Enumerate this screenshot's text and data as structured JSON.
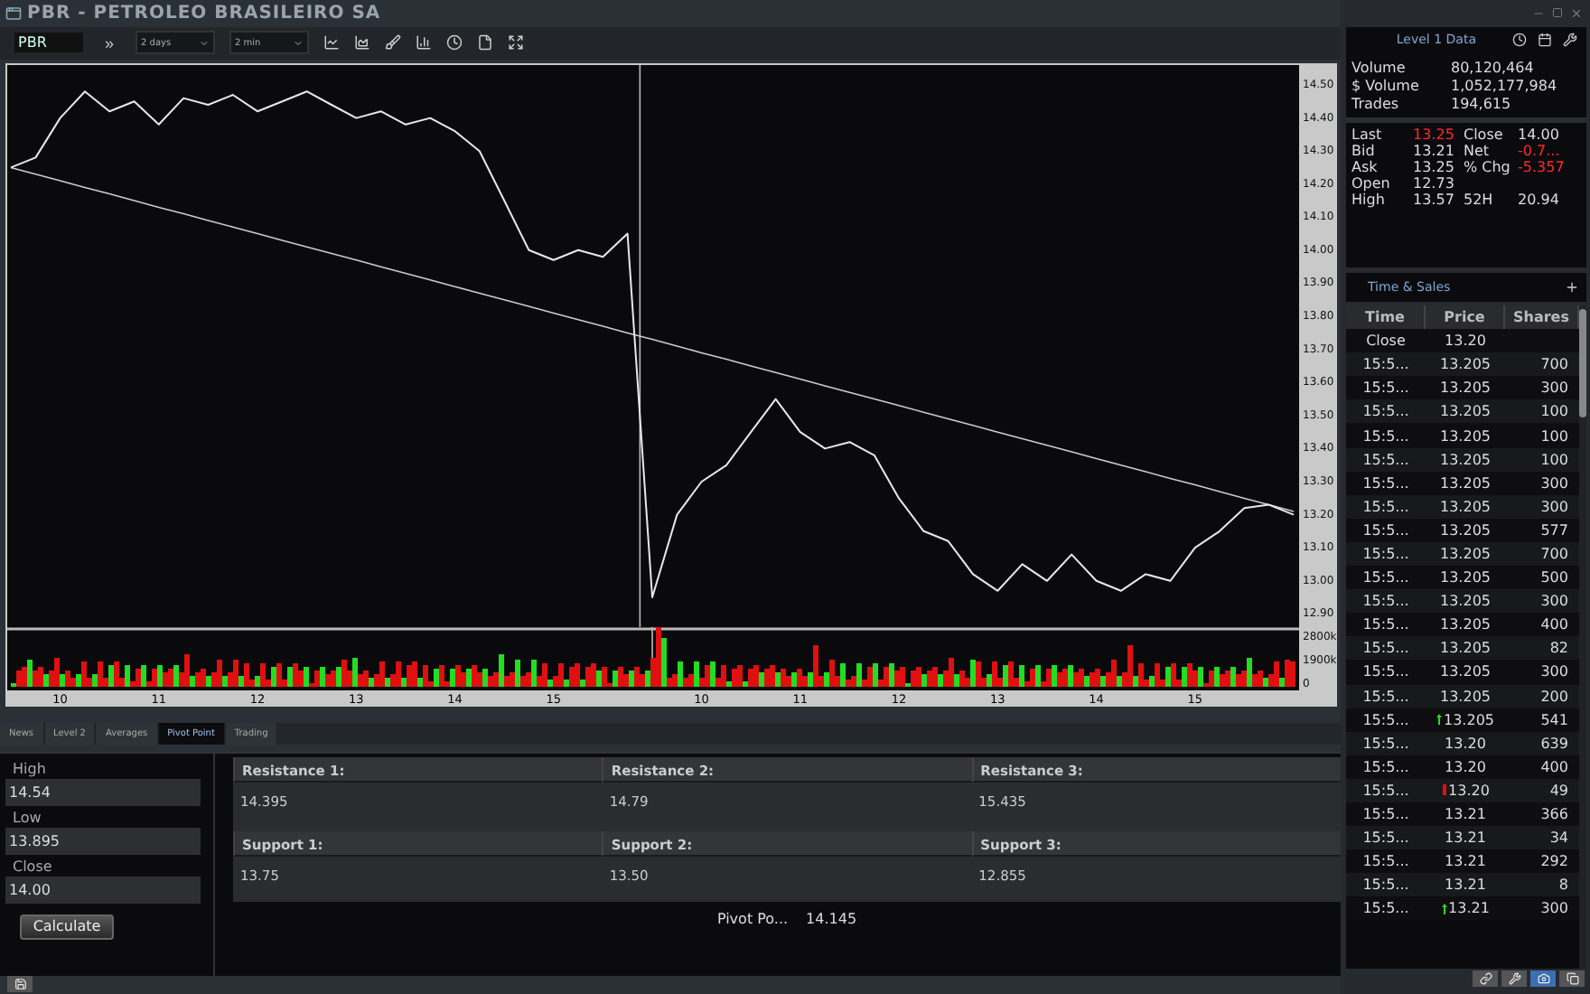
{
  "window": {
    "title": "PBR - PETROLEO BRASILEIRO SA"
  },
  "toolbar": {
    "symbol": "PBR",
    "go_label": "»",
    "period": "2 days",
    "interval": "2 min"
  },
  "chart": {
    "chart_data": {
      "type": "line",
      "ylim": [
        12.86,
        14.56
      ],
      "yticks": [
        {
          "value": 14.5,
          "label": "14.50"
        },
        {
          "value": 14.4,
          "label": "14.40"
        },
        {
          "value": 14.3,
          "label": "14.30"
        },
        {
          "value": 14.2,
          "label": "14.20"
        },
        {
          "value": 14.1,
          "label": "14.10"
        },
        {
          "value": 14.0,
          "label": "14.00"
        },
        {
          "value": 13.9,
          "label": "13.90"
        },
        {
          "value": 13.8,
          "label": "13.80"
        },
        {
          "value": 13.7,
          "label": "13.70"
        },
        {
          "value": 13.6,
          "label": "13.60"
        },
        {
          "value": 13.5,
          "label": "13.50"
        },
        {
          "value": 13.4,
          "label": "13.40"
        },
        {
          "value": 13.3,
          "label": "13.30"
        },
        {
          "value": 13.2,
          "label": "13.20"
        },
        {
          "value": 13.1,
          "label": "13.10"
        },
        {
          "value": 13.0,
          "label": "13.00"
        },
        {
          "value": 12.9,
          "label": "12.90"
        }
      ],
      "categories": [
        null,
        null,
        "10",
        null,
        null,
        null,
        "11",
        null,
        null,
        null,
        "12",
        null,
        null,
        null,
        "13",
        null,
        null,
        null,
        "14",
        null,
        null,
        null,
        "15",
        null,
        null,
        null,
        null,
        null,
        "10",
        null,
        null,
        null,
        "11",
        null,
        null,
        null,
        "12",
        null,
        null,
        null,
        "13",
        null,
        null,
        null,
        "14",
        null,
        null,
        null,
        "15",
        null,
        null,
        null,
        null
      ],
      "series": [
        {
          "color": "#cccccc",
          "values": [
            14.25,
            14.23,
            14.21,
            14.19,
            14.17,
            14.15,
            14.13,
            14.11,
            14.09,
            14.07,
            14.05,
            14.03,
            14.01,
            13.99,
            13.97,
            13.95,
            13.93,
            13.91,
            13.89,
            13.87,
            13.85,
            13.83,
            13.81,
            13.79,
            13.77,
            13.75,
            13.73,
            13.71,
            13.69,
            13.67,
            13.65,
            13.63,
            13.61,
            13.59,
            13.57,
            13.55,
            13.53,
            13.51,
            13.49,
            13.47,
            13.45,
            13.43,
            13.41,
            13.39,
            13.37,
            13.35,
            13.33,
            13.31,
            13.29,
            13.27,
            13.25,
            13.23,
            13.21
          ]
        },
        {
          "color": "#e8e8e8",
          "values": [
            14.25,
            14.28,
            14.4,
            14.48,
            14.42,
            14.45,
            14.38,
            14.46,
            14.44,
            14.47,
            14.42,
            14.45,
            14.48,
            14.44,
            14.4,
            14.42,
            14.38,
            14.4,
            14.36,
            14.3,
            14.15,
            14.0,
            13.97,
            14.0,
            13.98,
            14.05,
            12.95,
            13.2,
            13.3,
            13.35,
            13.45,
            13.55,
            13.45,
            13.4,
            13.42,
            13.38,
            13.25,
            13.15,
            13.12,
            13.02,
            12.97,
            13.05,
            13.0,
            13.08,
            13.0,
            12.97,
            13.02,
            13.0,
            13.1,
            13.15,
            13.22,
            13.23,
            13.2
          ]
        }
      ]
    },
    "volume_ticks": [
      "2800k",
      "1900k",
      "0"
    ]
  },
  "tabs": [
    {
      "label": "News",
      "selected": false
    },
    {
      "label": "Level 2",
      "selected": false
    },
    {
      "label": "Averages",
      "selected": false
    },
    {
      "label": "Pivot Point",
      "selected": true
    },
    {
      "label": "Trading",
      "selected": false
    }
  ],
  "pivot_inputs": [
    {
      "label": "High",
      "value": "14.54"
    },
    {
      "label": "Low",
      "value": "13.895"
    },
    {
      "label": "Close",
      "value": "14.00"
    }
  ],
  "calculate_label": "Calculate",
  "pivot_levels": [
    {
      "label": "Resistance 1:",
      "value": "14.395"
    },
    {
      "label": "Resistance 2:",
      "value": "14.79"
    },
    {
      "label": "Resistance 3:",
      "value": "15.435"
    },
    {
      "label": "Support 1:",
      "value": "13.75"
    },
    {
      "label": "Support 2:",
      "value": "13.50"
    },
    {
      "label": "Support 3:",
      "value": "12.855"
    }
  ],
  "pivot_result": {
    "label": "Pivot Po...",
    "value": "14.145"
  },
  "level1": {
    "title": "Level 1 Data",
    "volume_rows": [
      {
        "label": "Volume",
        "value": "80,120,464"
      },
      {
        "label": "$ Volume",
        "value": "1,052,177,984"
      },
      {
        "label": "Trades",
        "value": "194,615"
      }
    ],
    "quote_rows": [
      {
        "label": "Last",
        "value": "13.25",
        "value_red": true,
        "label2": "Close",
        "value2": "14.00",
        "value2_red": false
      },
      {
        "label": "Bid",
        "value": "13.21",
        "value_red": false,
        "label2": "Net",
        "value2": "-0.7...",
        "value2_red": true
      },
      {
        "label": "Ask",
        "value": "13.25",
        "value_red": false,
        "label2": "% Chg",
        "value2": "-5.357",
        "value2_red": true
      },
      {
        "label": "Open",
        "value": "12.73",
        "value_red": false
      },
      {
        "label": "High",
        "value": "13.57",
        "value_red": false,
        "label2": "52H",
        "value2": "20.94",
        "value2_red": false
      }
    ]
  },
  "time_sales": {
    "title": "Time & Sales",
    "columns": [
      "Time",
      "Price",
      "Shares"
    ],
    "rows": [
      {
        "kind": "plain",
        "time": "Close",
        "price": "13.20"
      },
      {
        "kind": "plain",
        "time": "15:5...",
        "price": "13.205",
        "shares": "700"
      },
      {
        "kind": "plain",
        "time": "15:5...",
        "price": "13.205",
        "shares": "300"
      },
      {
        "kind": "plain",
        "time": "15:5...",
        "price": "13.205",
        "shares": "100"
      },
      {
        "kind": "plain",
        "time": "15:5...",
        "price": "13.205",
        "shares": "100"
      },
      {
        "kind": "plain",
        "time": "15:5...",
        "price": "13.205",
        "shares": "100"
      },
      {
        "kind": "plain",
        "time": "15:5...",
        "price": "13.205",
        "shares": "300"
      },
      {
        "kind": "plain",
        "time": "15:5...",
        "price": "13.205",
        "shares": "300"
      },
      {
        "kind": "plain",
        "time": "15:5...",
        "price": "13.205",
        "shares": "577"
      },
      {
        "kind": "plain",
        "time": "15:5...",
        "price": "13.205",
        "shares": "700"
      },
      {
        "kind": "plain",
        "time": "15:5...",
        "price": "13.205",
        "shares": "500"
      },
      {
        "kind": "plain",
        "time": "15:5...",
        "price": "13.205",
        "shares": "300"
      },
      {
        "kind": "plain",
        "time": "15:5...",
        "price": "13.205",
        "shares": "400"
      },
      {
        "kind": "plain",
        "time": "15:5...",
        "price": "13.205",
        "shares": "82"
      },
      {
        "kind": "plain",
        "time": "15:5...",
        "price": "13.205",
        "shares": "300"
      },
      {
        "kind": "plain",
        "time": "15:5...",
        "price": "13.205",
        "shares": "200"
      },
      {
        "kind": "uptick",
        "time": "15:5...",
        "price": "13.205",
        "shares": "541"
      },
      {
        "kind": "plain",
        "time": "15:5...",
        "price": "13.20",
        "shares": "639"
      },
      {
        "kind": "plain",
        "time": "15:5...",
        "price": "13.20",
        "shares": "400"
      },
      {
        "kind": "downtick",
        "time": "15:5...",
        "price": "13.20",
        "shares": "49"
      },
      {
        "kind": "plain",
        "time": "15:5...",
        "price": "13.21",
        "shares": "366"
      },
      {
        "kind": "plain",
        "time": "15:5...",
        "price": "13.21",
        "shares": "34"
      },
      {
        "kind": "plain",
        "time": "15:5...",
        "price": "13.21",
        "shares": "292"
      },
      {
        "kind": "plain",
        "time": "15:5...",
        "price": "13.21",
        "shares": "8"
      },
      {
        "kind": "uptick",
        "time": "15:5...",
        "price": "13.21",
        "shares": "300"
      }
    ]
  }
}
